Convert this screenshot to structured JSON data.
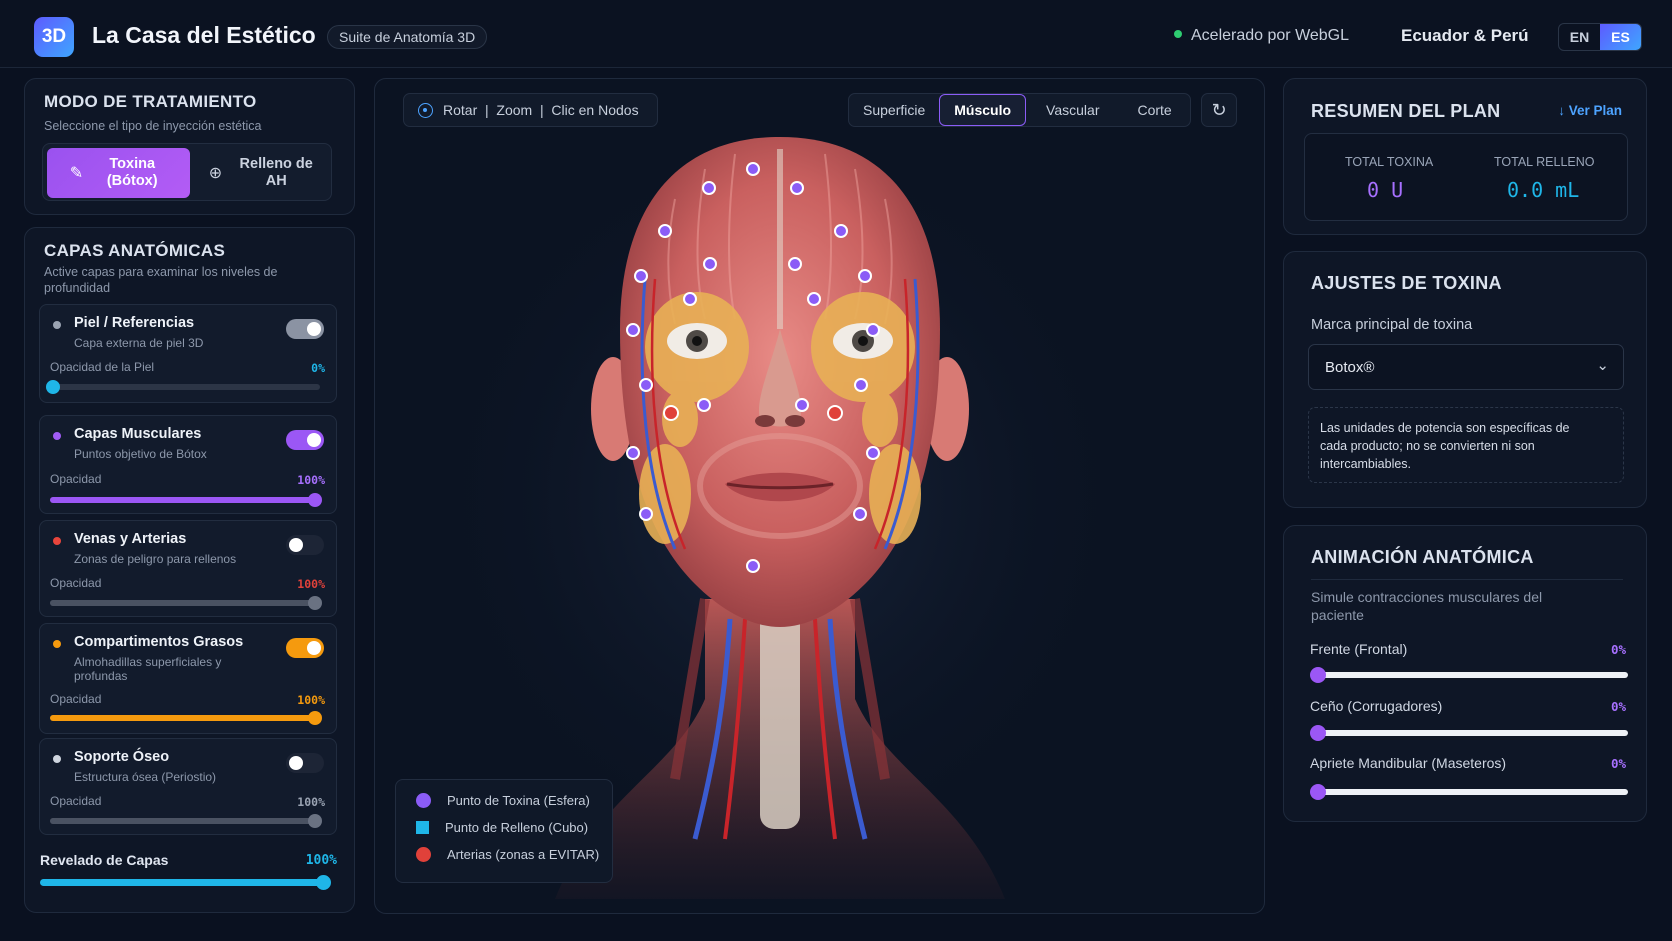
{
  "header": {
    "logo": "3D",
    "title": "La Casa del Estético",
    "suite_badge": "Suite de Anatomía 3D",
    "webgl_status": "Acelerado por WebGL",
    "region": "Ecuador & Perú",
    "lang_en": "EN",
    "lang_es": "ES",
    "active_lang": "ES"
  },
  "treatment": {
    "title": "MODO DE TRATAMIENTO",
    "subtitle": "Seleccione el tipo de inyección estética",
    "toxin_label": "Toxina (Bótox)",
    "filler_label": "Relleno de AH",
    "active": "toxina"
  },
  "layers": {
    "title": "CAPAS ANATÓMICAS",
    "subtitle": "Active capas para examinar los niveles de profundidad",
    "items": [
      {
        "name": "Piel / Referencias",
        "desc": "Capa externa de piel 3D",
        "opacity_label": "Opacidad de la Piel",
        "opacity": "0%",
        "value": 0,
        "on": true,
        "color": "#9aa3b2",
        "accent": "#1fb6e8"
      },
      {
        "name": "Capas Musculares",
        "desc": "Puntos objetivo de Bótox",
        "opacity_label": "Opacidad",
        "opacity": "100%",
        "value": 100,
        "on": true,
        "color": "#a05cf5",
        "accent": "#a05cf5"
      },
      {
        "name": "Venas y Arterias",
        "desc": "Zonas de peligro para rellenos",
        "opacity_label": "Opacidad",
        "opacity": "100%",
        "value": 100,
        "on": false,
        "color": "#e8453c",
        "accent": "#5a6170"
      },
      {
        "name": "Compartimentos Grasos",
        "desc": "Almohadillas superficiales y profundas",
        "opacity_label": "Opacidad",
        "opacity": "100%",
        "value": 100,
        "on": true,
        "color": "#f59a0e",
        "accent": "#f59a0e"
      },
      {
        "name": "Soporte Óseo",
        "desc": "Estructura ósea (Periostio)",
        "opacity_label": "Opacidad",
        "opacity": "100%",
        "value": 100,
        "on": false,
        "color": "#cfd5df",
        "accent": "#5a6170"
      }
    ],
    "reveal_label": "Revelado de Capas",
    "reveal_value": "100%"
  },
  "viewer": {
    "hint": "Rotar  |  Zoom  |  Clic en Nodos",
    "tabs": [
      "Superficie",
      "Músculo",
      "Vascular",
      "Corte"
    ],
    "active_tab": "Músculo",
    "legend": [
      {
        "label": "Punto de Toxina (Esfera)",
        "color": "#8b5cf6",
        "shape": "circle"
      },
      {
        "label": "Punto de Relleno (Cubo)",
        "color": "#1fb6e8",
        "shape": "square"
      },
      {
        "label": "Arterias (zonas a EVITAR)",
        "color": "#e0413a",
        "shape": "circle"
      }
    ]
  },
  "plan": {
    "title": "RESUMEN DEL PLAN",
    "view_link": "↓ Ver Plan",
    "total_toxin_label": "TOTAL TOXINA",
    "total_toxin_value": "0 U",
    "total_filler_label": "TOTAL RELLENO",
    "total_filler_value": "0.0 mL"
  },
  "toxin_settings": {
    "title": "AJUSTES DE TOXINA",
    "brand_label": "Marca principal de toxina",
    "brand_value": "Botox®",
    "note": "Las unidades de potencia son específicas de cada producto; no se convierten ni son intercambiables."
  },
  "animation": {
    "title": "ANIMACIÓN ANATÓMICA",
    "subtitle": "Simule contracciones musculares del paciente",
    "sliders": [
      {
        "label": "Frente (Frontal)",
        "value": "0%"
      },
      {
        "label": "Ceño (Corrugadores)",
        "value": "0%"
      },
      {
        "label": "Apriete Mandibular (Maseteros)",
        "value": "0%"
      }
    ]
  }
}
